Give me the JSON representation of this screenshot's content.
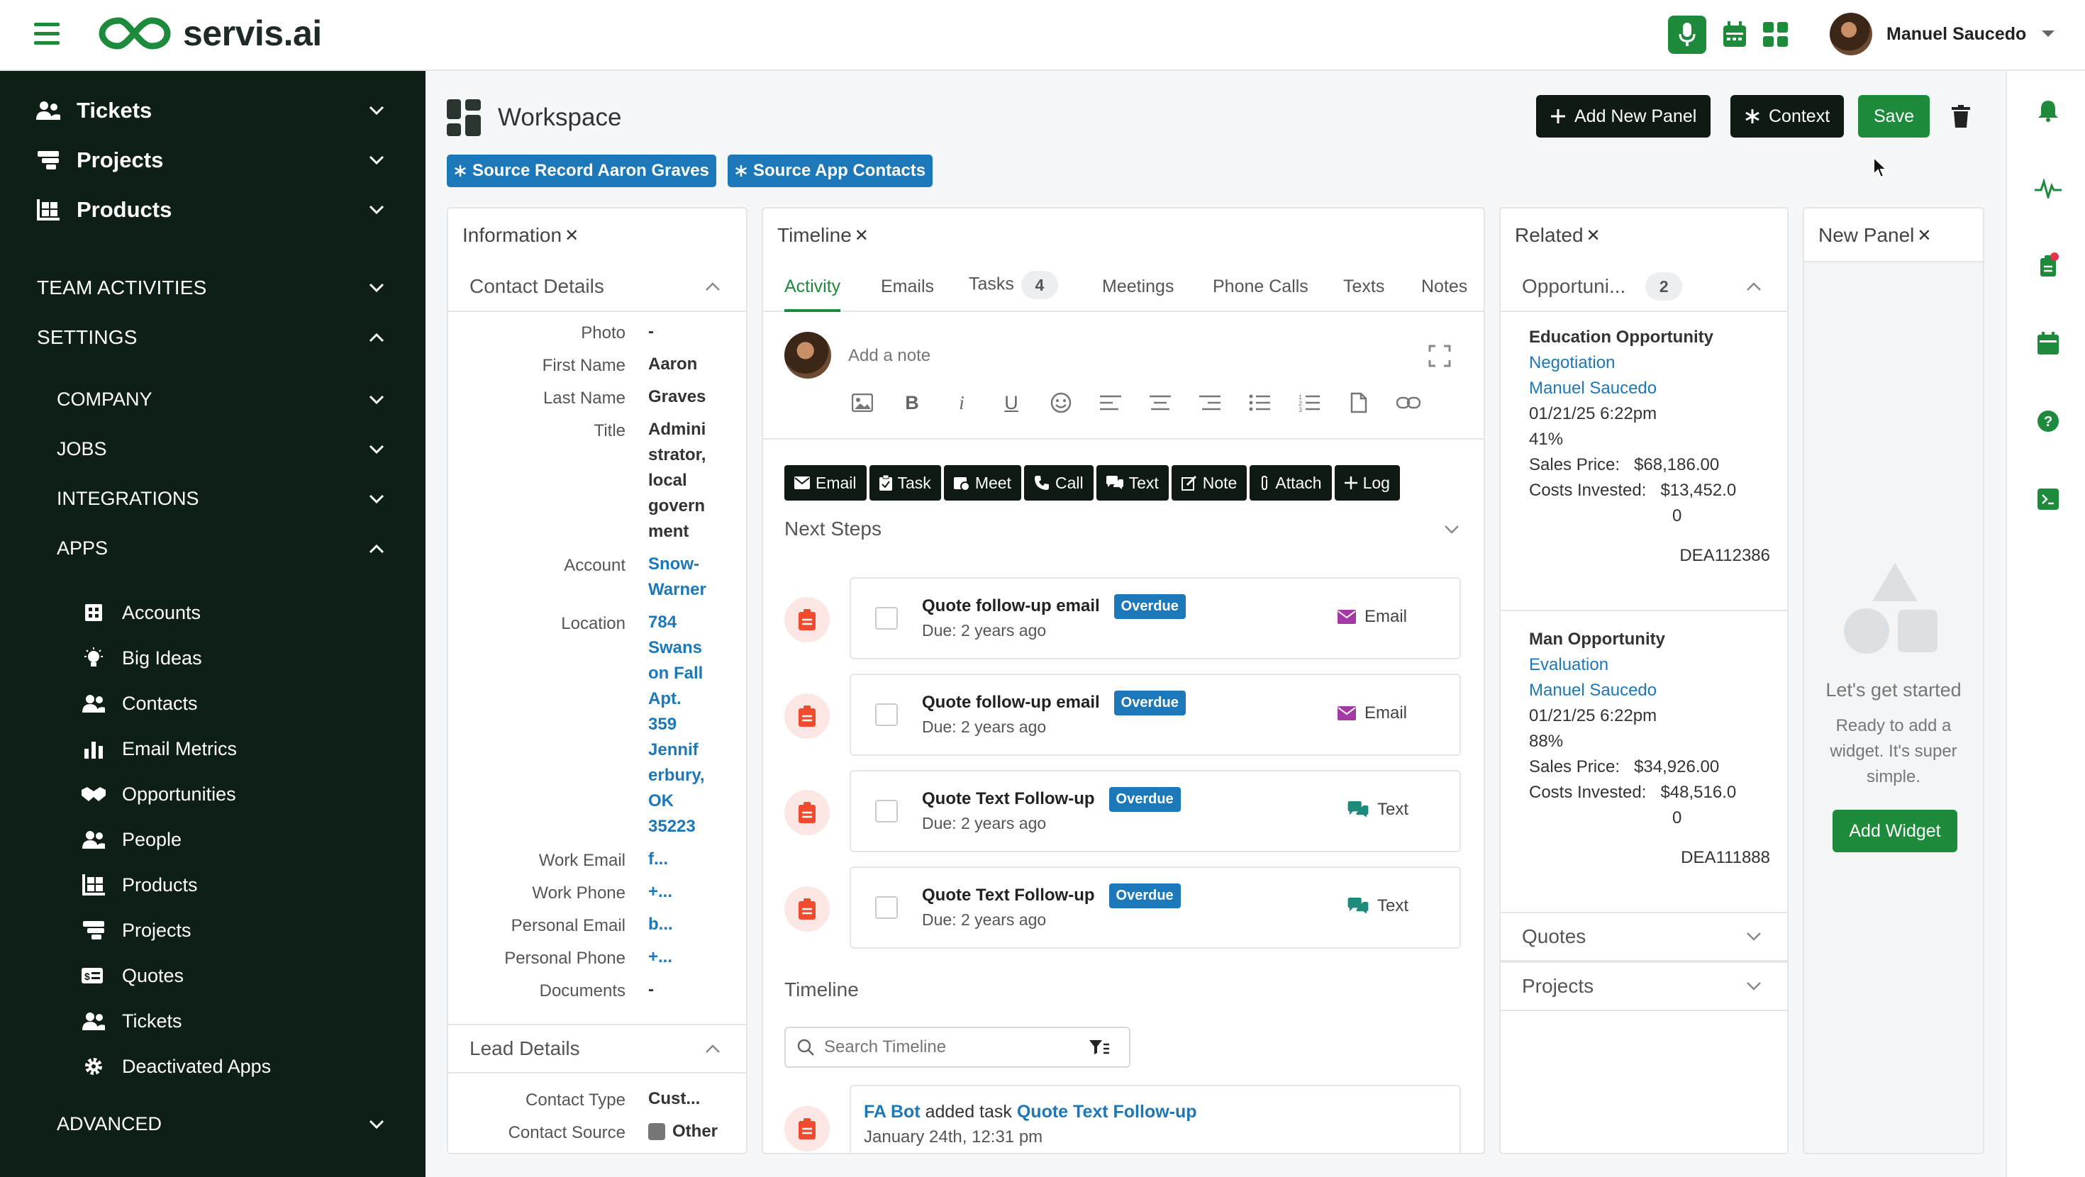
{
  "app": {
    "name": "servis.ai"
  },
  "colors": {
    "brand_green": "#1e8a3c",
    "sidebar_bg": "#0e1f16",
    "link_blue": "#1c78b8",
    "dark_button": "#0f1a14"
  },
  "topbar": {
    "user_name": "Manuel Saucedo",
    "icons": [
      "menu-icon",
      "mic-icon",
      "calendar-icon",
      "apps-grid-icon",
      "chevron-down-icon"
    ]
  },
  "sidebar": {
    "main": [
      {
        "label": "Tickets",
        "icon": "ticket-icon"
      },
      {
        "label": "Projects",
        "icon": "projects-icon"
      },
      {
        "label": "Products",
        "icon": "products-icon"
      }
    ],
    "sections": [
      "TEAM ACTIVITIES",
      "SETTINGS"
    ],
    "settings_items": [
      "COMPANY",
      "JOBS",
      "INTEGRATIONS",
      "APPS"
    ],
    "apps": [
      {
        "label": "Accounts",
        "icon": "accounts-icon"
      },
      {
        "label": "Big Ideas",
        "icon": "bulb-icon"
      },
      {
        "label": "Contacts",
        "icon": "contacts-icon"
      },
      {
        "label": "Email Metrics",
        "icon": "bar-chart-icon"
      },
      {
        "label": "Opportunities",
        "icon": "handshake-icon"
      },
      {
        "label": "People",
        "icon": "people-icon"
      },
      {
        "label": "Products",
        "icon": "products-icon"
      },
      {
        "label": "Projects",
        "icon": "projects-icon"
      },
      {
        "label": "Quotes",
        "icon": "quotes-icon"
      },
      {
        "label": "Tickets",
        "icon": "people-icon"
      },
      {
        "label": "Deactivated Apps",
        "icon": "gear-icon"
      }
    ],
    "advanced": "ADVANCED"
  },
  "workspace": {
    "title": "Workspace",
    "buttons": {
      "add_panel": "Add New Panel",
      "context": "Context",
      "save": "Save"
    },
    "chips": [
      "Source Record Aaron Graves",
      "Source App Contacts"
    ]
  },
  "info_panel": {
    "title": "Information",
    "contact_section": "Contact Details",
    "fields": [
      {
        "label": "Photo",
        "value": "-"
      },
      {
        "label": "First Name",
        "value": "Aaron"
      },
      {
        "label": "Last Name",
        "value": "Graves"
      },
      {
        "label": "Title",
        "value": "Administrator, local government"
      },
      {
        "label": "Account",
        "value": "Snow-Warner"
      },
      {
        "label": "Location",
        "value": "784 Swanson Fall Apt. 359 Jenniferbury, OK 35223"
      },
      {
        "label": "Work Email",
        "value": "f..."
      },
      {
        "label": "Work Phone",
        "value": "+..."
      },
      {
        "label": "Personal Email",
        "value": "b..."
      },
      {
        "label": "Personal Phone",
        "value": "+..."
      },
      {
        "label": "Documents",
        "value": "-"
      }
    ],
    "title_lines": [
      "Admini",
      "strator,",
      "local",
      "govern",
      "ment"
    ],
    "account_lines": [
      "Snow-",
      "Warner"
    ],
    "location_lines": [
      "784",
      "Swans",
      "on Fall",
      "Apt.",
      "359",
      "Jennif",
      "erbury,",
      "OK",
      "35223"
    ],
    "lead_section": "Lead Details",
    "lead_fields": [
      {
        "label": "Contact Type",
        "value": "Cust..."
      },
      {
        "label": "Contact Source",
        "value": "Other"
      }
    ]
  },
  "timeline_panel": {
    "title": "Timeline",
    "tabs": [
      {
        "label": "Activity"
      },
      {
        "label": "Emails"
      },
      {
        "label": "Tasks",
        "count": "4"
      },
      {
        "label": "Meetings"
      },
      {
        "label": "Phone Calls"
      },
      {
        "label": "Texts"
      },
      {
        "label": "Notes"
      }
    ],
    "note_placeholder": "Add a note",
    "actions": [
      "Email",
      "Task",
      "Meet",
      "Call",
      "Text",
      "Note",
      "Attach",
      "Log"
    ],
    "next_steps": "Next Steps",
    "tasks": [
      {
        "title": "Quote follow-up email",
        "status": "Overdue",
        "due": "Due: 2 years ago",
        "kind": "Email"
      },
      {
        "title": "Quote follow-up email",
        "status": "Overdue",
        "due": "Due: 2 years ago",
        "kind": "Email"
      },
      {
        "title": "Quote Text Follow-up",
        "status": "Overdue",
        "due": "Due: 2 years ago",
        "kind": "Text"
      },
      {
        "title": "Quote Text Follow-up",
        "status": "Overdue",
        "due": "Due: 2 years ago",
        "kind": "Text"
      }
    ],
    "timeline_label": "Timeline",
    "search_placeholder": "Search Timeline",
    "entry": {
      "actor": "FA Bot",
      "verb": "added task",
      "task": "Quote Text Follow-up",
      "date": "January 24th, 12:31 pm"
    }
  },
  "related_panel": {
    "title": "Related",
    "section": "Opportuni...",
    "count": "2",
    "opportunities": [
      {
        "name": "Education Opportunity",
        "stage": "Negotiation",
        "owner": "Manuel Saucedo",
        "date": "01/21/25 6:22pm",
        "prob": "41%",
        "sales_label": "Sales Price:",
        "sales": "$68,186.00",
        "cost_label": "Costs Invested:",
        "cost_a": "$13,452.0",
        "cost_b": "0",
        "code": "DEA112386"
      },
      {
        "name": "Man Opportunity",
        "stage": "Evaluation",
        "owner": "Manuel Saucedo",
        "date": "01/21/25 6:22pm",
        "prob": "88%",
        "sales_label": "Sales Price:",
        "sales": "$34,926.00",
        "cost_label": "Costs Invested:",
        "cost_a": "$48,516.0",
        "cost_b": "0",
        "code": "DEA111888"
      }
    ],
    "other_sections": [
      "Quotes",
      "Projects"
    ]
  },
  "new_panel": {
    "title": "New Panel",
    "heading": "Let's get started",
    "text_lines": [
      "Ready to add a",
      "widget. It's super",
      "simple."
    ],
    "button": "Add Widget"
  },
  "rightbar_icons": [
    "bell-icon",
    "activity-icon",
    "clipboard-icon",
    "calendar-icon",
    "help-icon",
    "terminal-icon"
  ]
}
